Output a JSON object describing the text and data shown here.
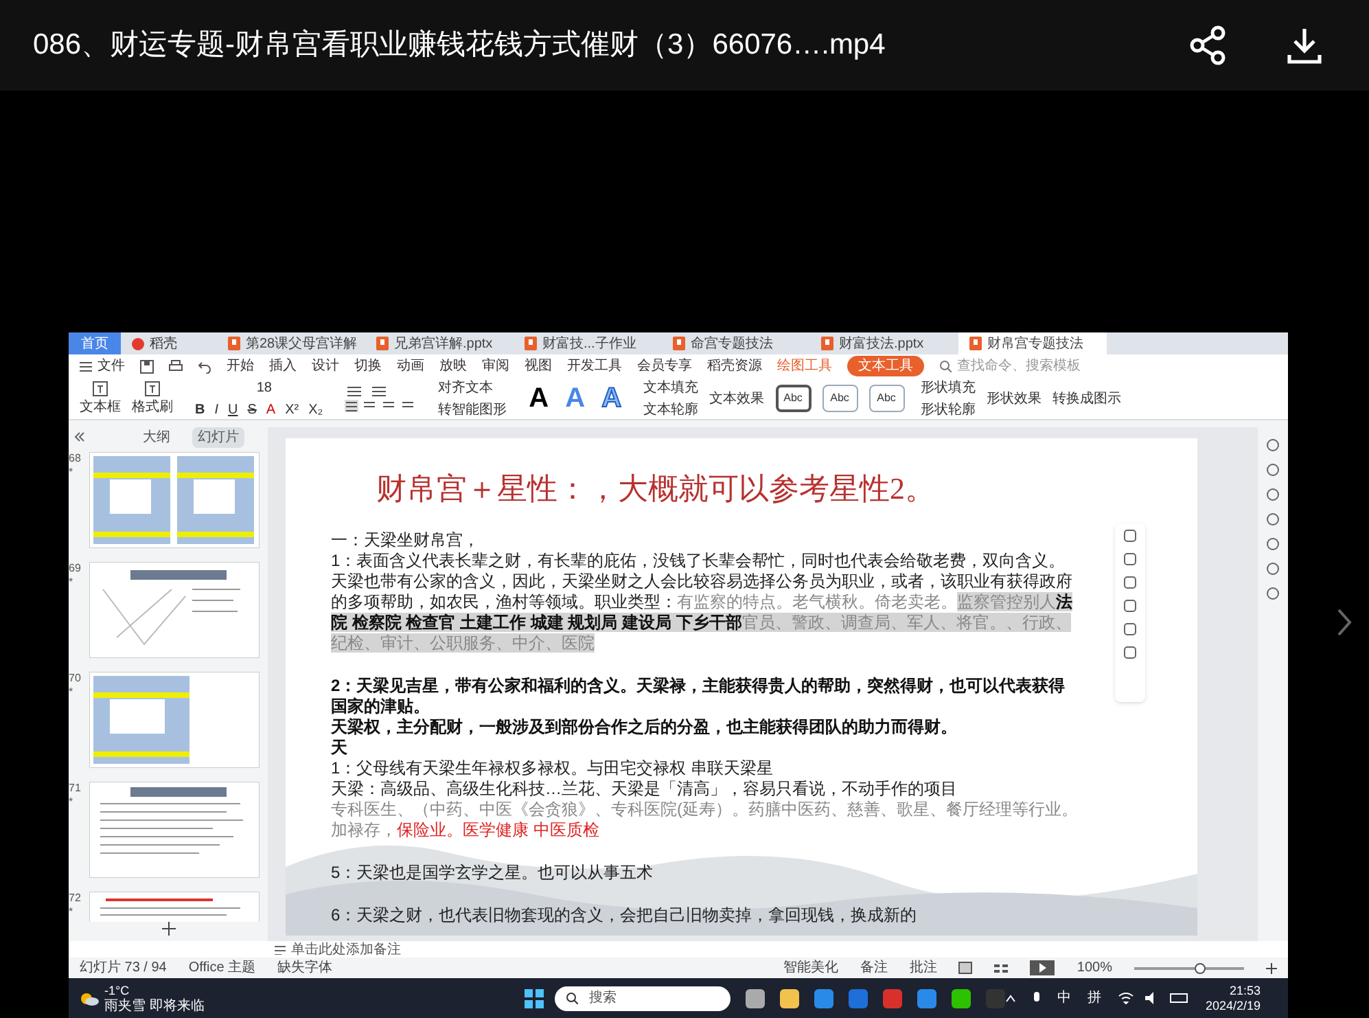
{
  "player": {
    "title": "086、财运专题-财帛宫看职业赚钱花钱方式催财（3）66076….mp4"
  },
  "app": {
    "tabs": [
      {
        "label": "首页",
        "kind": "home",
        "selected": false
      },
      {
        "label": "稻壳",
        "kind": "docer",
        "selected": false
      },
      {
        "label": "第28课父母宫详解",
        "kind": "doc",
        "selected": false
      },
      {
        "label": "兄弟宫详解.pptx",
        "kind": "doc",
        "selected": false
      },
      {
        "label": "财富技...子作业",
        "kind": "doc",
        "selected": false
      },
      {
        "label": "命宫专题技法",
        "kind": "doc",
        "selected": false
      },
      {
        "label": "财富技法.pptx",
        "kind": "doc",
        "selected": false
      },
      {
        "label": "财帛宫专题技法",
        "kind": "doc",
        "selected": true
      }
    ],
    "file_menu": "文件",
    "menu_items": [
      {
        "label": "开始",
        "kind": "tab",
        "selected": false
      },
      {
        "label": "插入",
        "kind": "tab",
        "selected": false
      },
      {
        "label": "设计",
        "kind": "tab",
        "selected": false
      },
      {
        "label": "切换",
        "kind": "tab",
        "selected": false
      },
      {
        "label": "动画",
        "kind": "tab",
        "selected": false
      },
      {
        "label": "放映",
        "kind": "tab",
        "selected": false
      },
      {
        "label": "审阅",
        "kind": "tab",
        "selected": false
      },
      {
        "label": "视图",
        "kind": "tab",
        "selected": false
      },
      {
        "label": "开发工具",
        "kind": "tab",
        "selected": false
      },
      {
        "label": "会员专享",
        "kind": "tab",
        "selected": false
      },
      {
        "label": "稻壳资源",
        "kind": "tab",
        "selected": false
      },
      {
        "label": "绘图工具",
        "kind": "tool",
        "selected": false
      },
      {
        "label": "文本工具",
        "kind": "tool",
        "selected": true
      }
    ],
    "search": {
      "placeholder": "查找命令、搜索模板"
    },
    "ribbon": {
      "text_box": "文本框",
      "format_painter": "格式刷",
      "font_size": "18",
      "format_buttons": [
        "B",
        "I",
        "U",
        "S",
        "A",
        "X²",
        "X₂"
      ],
      "align_text": "对齐文本",
      "smart_art": "转智能图形",
      "art_letters": [
        {
          "label": "A",
          "kind": "solid-dark"
        },
        {
          "label": "A",
          "kind": "solid-blue"
        },
        {
          "label": "A",
          "kind": "outline-blue"
        }
      ],
      "text_fill": "文本填充",
      "text_outline": "文本轮廓",
      "text_effect": "文本效果",
      "style_samples": [
        {
          "label": "Abc",
          "selected": true
        },
        {
          "label": "Abc",
          "selected": false
        },
        {
          "label": "Abc",
          "selected": false
        }
      ],
      "shape_fill": "形状填充",
      "shape_outline": "形状轮廓",
      "shape_effect": "形状效果",
      "convert": "转换成图示"
    },
    "panel": {
      "tabs": [
        {
          "label": "大纲",
          "selected": false
        },
        {
          "label": "幻灯片",
          "selected": true
        }
      ],
      "slides": [
        {
          "number": "68",
          "mark": "*",
          "kind": "diagram-pair"
        },
        {
          "number": "69",
          "mark": "*",
          "kind": "sketch"
        },
        {
          "number": "70",
          "mark": "*",
          "kind": "diagram"
        },
        {
          "number": "71",
          "mark": "*",
          "kind": "text"
        },
        {
          "number": "72",
          "mark": "*",
          "kind": "redtext"
        }
      ]
    },
    "slide": {
      "title": "财帛宫＋星性：，大概就可以参考星性2。",
      "paragraphs": [
        {
          "lines": [
            [
              {
                "text": "一：天梁坐财帛宫，",
                "kind": "plain",
                "highlight": false
              }
            ],
            [
              {
                "text": "1：表面含义代表长辈之财，有长辈的庇佑，没钱了长辈会帮忙，同时也代表会给敬老费，双向含义。",
                "kind": "plain",
                "highlight": false
              }
            ],
            [
              {
                "text": "天梁也带有公家的含义，因此，天梁坐财之人会比较容易选择公务员为职业，或者，该职业有获得政府",
                "kind": "plain",
                "highlight": false
              }
            ],
            [
              {
                "text": "的多项帮助，如农民，渔村等领域。职业类型：",
                "kind": "plain",
                "highlight": false
              },
              {
                "text": "有监察的特点。老气横秋。倚老卖老。",
                "kind": "muted",
                "highlight": false
              },
              {
                "text": "监察管控别人",
                "kind": "muted",
                "highlight": true
              },
              {
                "text": "法",
                "kind": "strong",
                "highlight": true
              }
            ],
            [
              {
                "text": "院 检察院 检查官 土建工作 城建 规划局  建设局 下乡干部",
                "kind": "strong",
                "highlight": true
              },
              {
                "text": "官员、警政、调查局、军人、将官。、行政、",
                "kind": "muted",
                "highlight": true
              }
            ],
            [
              {
                "text": "纪检、审计、公职服务、中介、医院",
                "kind": "muted",
                "highlight": true
              }
            ]
          ]
        },
        {
          "lines": [
            [
              {
                "text": "2：天梁见吉星，带有公家和福利的含义。天梁禄，主能获得贵人的帮助，突然得财，也可以代表获得",
                "kind": "strong",
                "highlight": false
              }
            ],
            [
              {
                "text": "国家的津贴。",
                "kind": "strong",
                "highlight": false
              }
            ],
            [
              {
                "text": "天梁权，主分配财，一般涉及到部份合作之后的分盈，也主能获得团队的助力而得财。",
                "kind": "strong",
                "highlight": false
              }
            ],
            [
              {
                "text": "天",
                "kind": "strong",
                "highlight": false
              }
            ],
            [
              {
                "text": "1：父母线有天梁生年禄权多禄权。与田宅交禄权 串联天梁星",
                "kind": "plain",
                "highlight": false
              }
            ],
            [
              {
                "text": "天梁：高级品、高级生化科技…兰花、天梁是「清高」，容易只看说，不动手作的项目",
                "kind": "plain",
                "highlight": false
              }
            ],
            [
              {
                "text": "专科医生、（中药、中医《会贪狼》、专科医院(延寿）。药膳中医药、慈善、歌星、餐厅经理等行业。",
                "kind": "muted",
                "highlight": false
              }
            ],
            [
              {
                "text": "加禄存，",
                "kind": "muted",
                "highlight": false
              },
              {
                "text": "保险业。医学健康 中医质检",
                "kind": "alert",
                "highlight": false
              }
            ]
          ]
        },
        {
          "lines": [
            [
              {
                "text": "5：天梁也是国学玄学之星。也可以从事五术",
                "kind": "plain",
                "highlight": false
              }
            ]
          ]
        },
        {
          "lines": [
            [
              {
                "text": "6：天梁之财，也代表旧物套现的含义，会把自己旧物卖掉，拿回现钱，换成新的",
                "kind": "plain",
                "highlight": false
              }
            ]
          ]
        }
      ]
    },
    "notes": {
      "placeholder": "单击此处添加备注"
    },
    "status": {
      "slide": "幻灯片 73 / 94",
      "theme": "Office 主题",
      "missing_font": "缺失字体",
      "beautify": "智能美化",
      "notes": "备注",
      "comments": "批注",
      "zoom": "100%",
      "zoom_slider": {
        "level": 0.6
      }
    }
  },
  "taskbar": {
    "weather": {
      "temp": "-1°C",
      "text": "雨夹雪 即将来临"
    },
    "search": {
      "placeholder": "搜索"
    },
    "tray": [
      "中",
      "拼"
    ],
    "time": "21:53",
    "date": "2024/2/19"
  }
}
